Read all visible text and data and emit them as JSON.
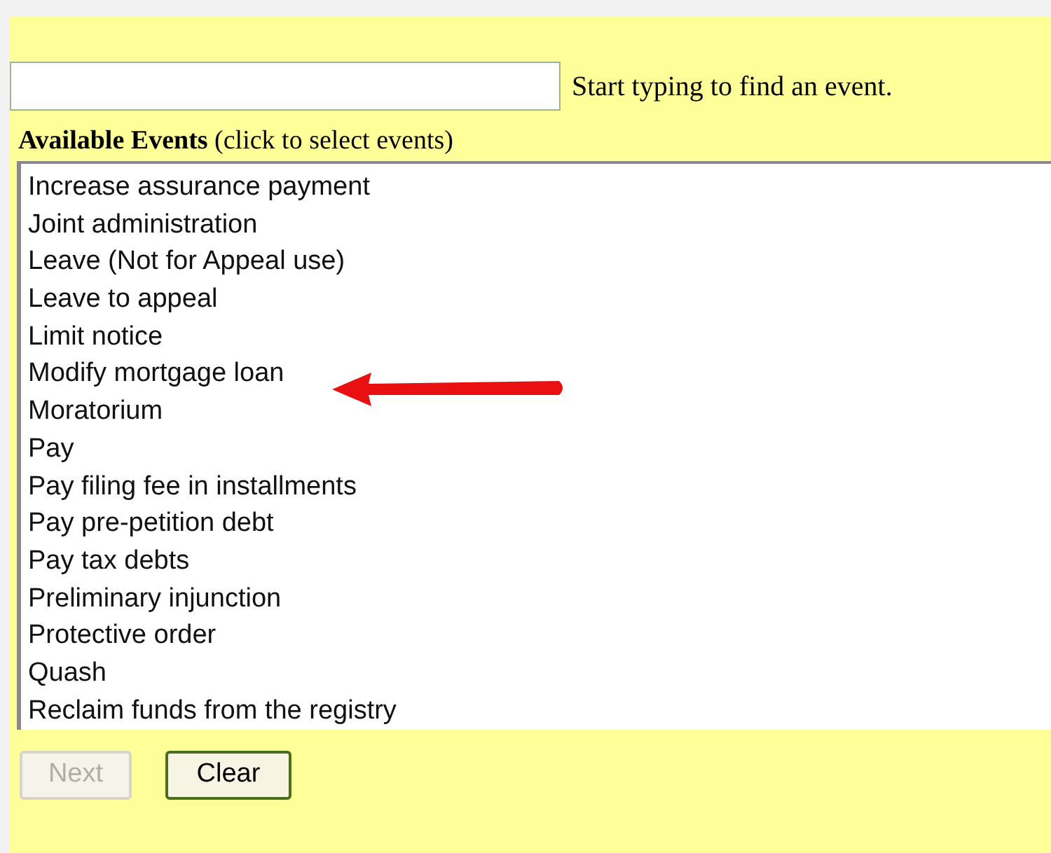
{
  "search": {
    "hint": "Start typing to find an event."
  },
  "heading": {
    "title": "Available Events",
    "note": "(click to select events)"
  },
  "events": [
    {
      "label": "Increase assurance payment",
      "selected": false
    },
    {
      "label": "Joint administration",
      "selected": false
    },
    {
      "label": "Leave (Not for Appeal use)",
      "selected": false
    },
    {
      "label": "Leave to appeal",
      "selected": false
    },
    {
      "label": "Limit notice",
      "selected": false
    },
    {
      "label": "Modify mortgage loan",
      "selected": false
    },
    {
      "label": "Moratorium",
      "selected": false
    },
    {
      "label": "Pay",
      "selected": false
    },
    {
      "label": "Pay filing fee in installments",
      "selected": false
    },
    {
      "label": "Pay pre-petition debt",
      "selected": false
    },
    {
      "label": "Pay tax debts",
      "selected": false
    },
    {
      "label": "Preliminary injunction",
      "selected": false
    },
    {
      "label": "Protective order",
      "selected": false
    },
    {
      "label": "Quash",
      "selected": false
    },
    {
      "label": "Reclaim funds from the registry",
      "selected": false
    }
  ],
  "buttons": [
    {
      "label": "Next",
      "disabled": true
    },
    {
      "label": "Clear",
      "disabled": false
    }
  ]
}
